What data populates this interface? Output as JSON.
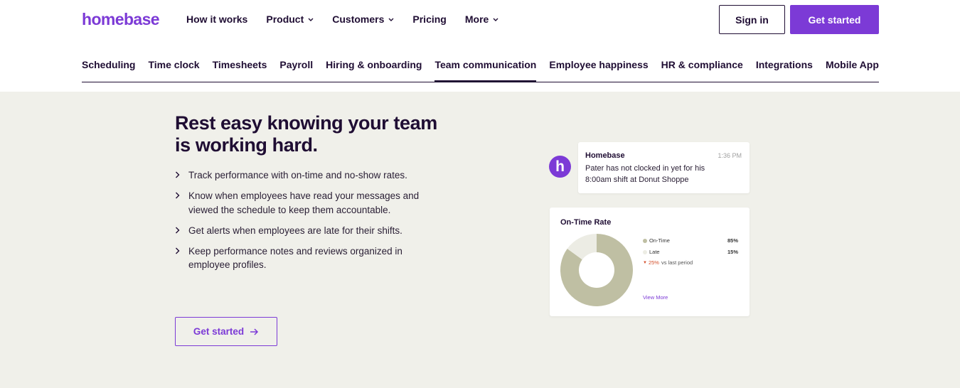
{
  "brand": {
    "logo_text": "homebase",
    "accent": "#7c3ad6",
    "dark": "#1f0d33",
    "hero_bg": "#f0f0ea"
  },
  "topnav": {
    "items": [
      {
        "label": "How it works",
        "has_dropdown": false
      },
      {
        "label": "Product",
        "has_dropdown": true
      },
      {
        "label": "Customers",
        "has_dropdown": true
      },
      {
        "label": "Pricing",
        "has_dropdown": false
      },
      {
        "label": "More",
        "has_dropdown": true
      }
    ],
    "sign_in": "Sign in",
    "get_started": "Get started"
  },
  "subnav": {
    "items": [
      "Scheduling",
      "Time clock",
      "Timesheets",
      "Payroll",
      "Hiring & onboarding",
      "Team communication",
      "Employee happiness",
      "HR & compliance",
      "Integrations",
      "Mobile App"
    ],
    "active": "Team communication"
  },
  "hero": {
    "headline_line1": "Rest easy knowing your team",
    "headline_line2": "is working hard.",
    "benefits": [
      "Track performance with on-time and no-show rates.",
      "Know when employees have read your messages and viewed the schedule to keep them accountable.",
      "Get alerts when employees are late for their shifts.",
      "Keep performance notes and reviews organized in employee profiles."
    ],
    "cta_label": "Get started",
    "cta_icon": "arrow-right-icon"
  },
  "notification": {
    "avatar_letter": "h",
    "sender": "Homebase",
    "time": "1:36 PM",
    "message": "Pater has not clocked in yet for his 8:00am shift at Donut Shoppe"
  },
  "on_time_card": {
    "title": "On-Time Rate",
    "legend": [
      {
        "label": "On-Time",
        "value": "85%",
        "color": "#bfbfa3"
      },
      {
        "label": "Late",
        "value": "15%",
        "color": "#ecece4"
      }
    ],
    "change_value": "25%",
    "change_text": "vs last period",
    "change_direction": "down",
    "view_more": "View More"
  },
  "chart_data": {
    "type": "pie",
    "title": "On-Time Rate",
    "categories": [
      "On-Time",
      "Late"
    ],
    "values": [
      85,
      15
    ],
    "colors": [
      "#bfbfa3",
      "#ecece4"
    ],
    "donut": true
  }
}
